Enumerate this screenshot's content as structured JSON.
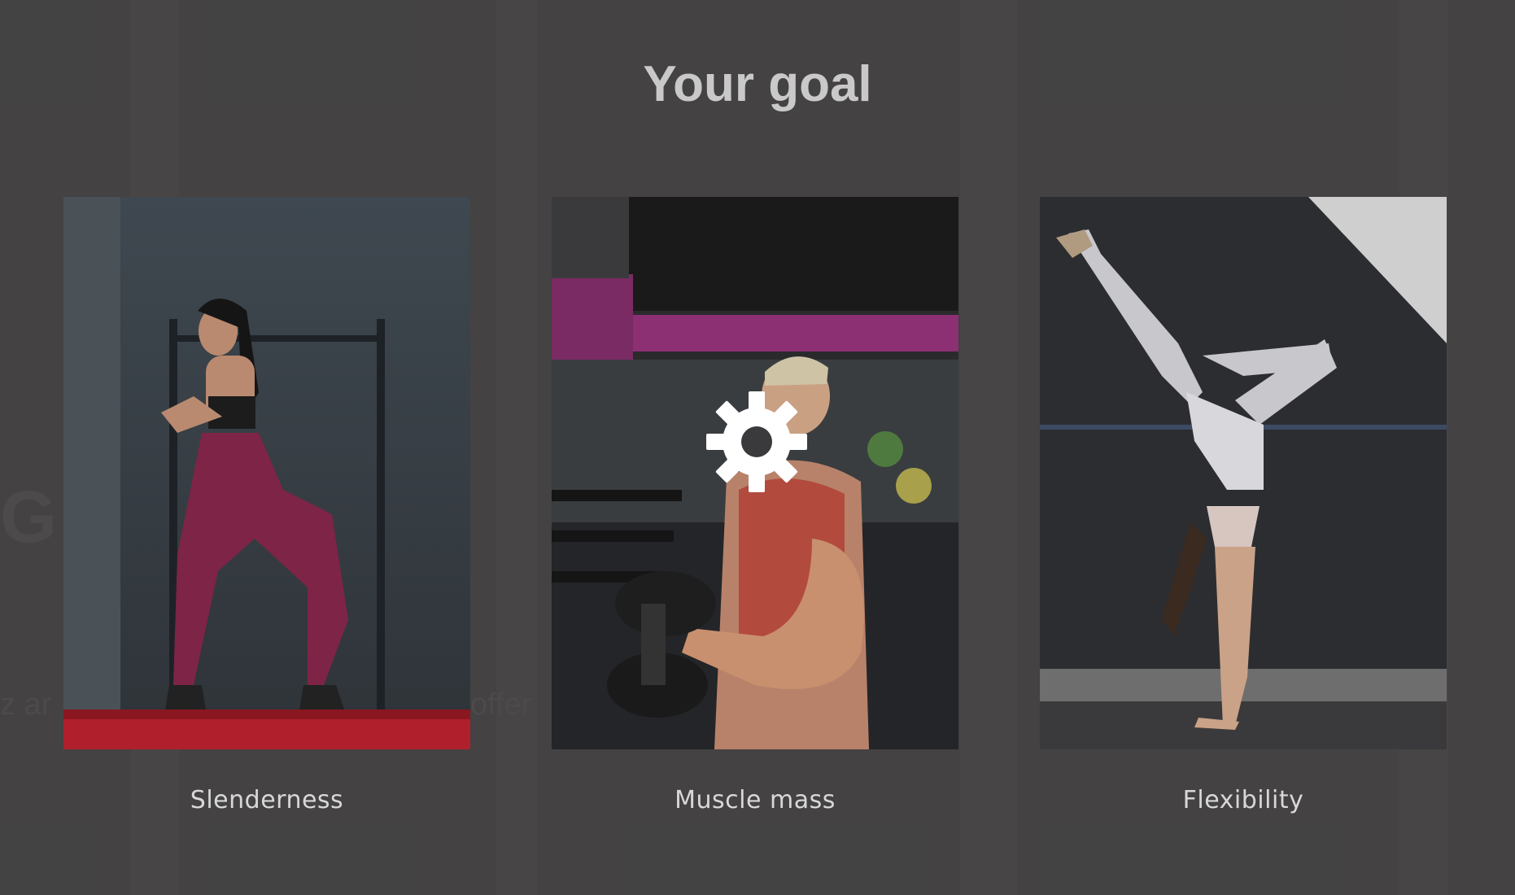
{
  "page": {
    "title": "Your goal",
    "background_color": "#474646",
    "title_color": "#c9c9c9",
    "label_color": "#d8d8d8"
  },
  "background_ghost_text": {
    "left_heading": "G",
    "left_line": "z ar",
    "middle_line": "offer"
  },
  "goals": [
    {
      "label": "Slenderness",
      "image": "woman-squatting-on-red-box-in-gym"
    },
    {
      "label": "Muscle mass",
      "image": "man-doing-dumbbell-curl-in-gym"
    },
    {
      "label": "Flexibility",
      "image": "woman-doing-handstand-split"
    }
  ],
  "loading_indicator": {
    "icon": "gear-icon",
    "color": "#ffffff"
  }
}
